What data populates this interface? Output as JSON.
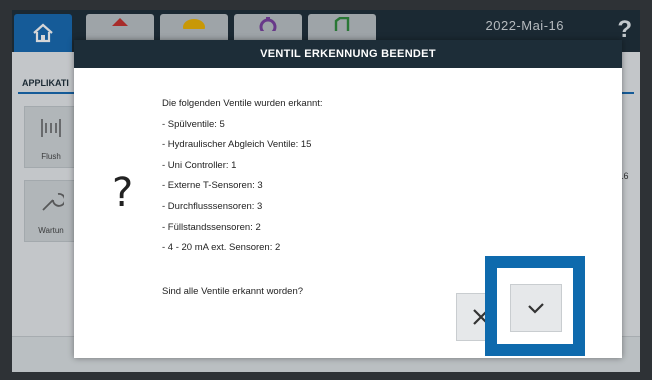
{
  "header": {
    "date": "2022-Mai-16",
    "help_label": "?"
  },
  "tabs": [
    {
      "icon": "home-icon",
      "color": "#1569b2"
    },
    {
      "icon": "red-icon",
      "color": "#c9302c"
    },
    {
      "icon": "yellow-icon",
      "color": "#f0b400"
    },
    {
      "icon": "gear-icon",
      "color": "#7a3fa0"
    },
    {
      "icon": "green-icon",
      "color": "#2e8b3a"
    }
  ],
  "background": {
    "section_label": "APPLIKATI",
    "cards": [
      {
        "label": "Flush",
        "icon": "flush-icon"
      },
      {
        "label": "Wartun",
        "icon": "wrench-icon"
      }
    ],
    "date_fragment": "22-Mai-16"
  },
  "dialog": {
    "title": "VENTIL ERKENNUNG BEENDET",
    "question_mark": "?",
    "intro": "Die folgenden Ventile wurden erkannt:",
    "items": [
      "- Spülventile: 5",
      "- Hydraulischer Abgleich Ventile: 15",
      "- Uni Controller: 1",
      "- Externe T-Sensoren: 3",
      "- Durchflusssensoren: 3",
      "- Füllstandssensoren: 2",
      "- 4 - 20 mA ext. Sensoren: 2"
    ],
    "question": "Sind alle Ventile erkannt worden?",
    "cancel_icon": "close-icon",
    "confirm_icon": "checkmark-icon"
  },
  "colors": {
    "accent": "#1569b2",
    "header": "#1d2d38",
    "highlight": "#0e6aad"
  }
}
